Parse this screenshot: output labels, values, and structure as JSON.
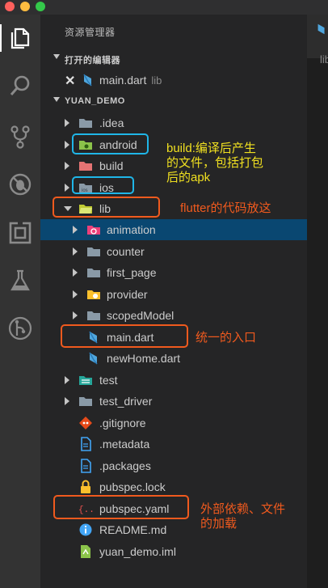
{
  "sidebar": {
    "title": "资源管理器",
    "open_editors": {
      "header": "打开的编辑器",
      "items": [
        {
          "name": "main.dart",
          "desc": "lib"
        }
      ]
    },
    "project": {
      "header": "YUAN_DEMO",
      "items": [
        {
          "label": ".idea"
        },
        {
          "label": "android"
        },
        {
          "label": "build"
        },
        {
          "label": "ios"
        },
        {
          "label": "lib"
        },
        {
          "label": "animation"
        },
        {
          "label": "counter"
        },
        {
          "label": "first_page"
        },
        {
          "label": "provider"
        },
        {
          "label": "scopedModel"
        },
        {
          "label": "main.dart"
        },
        {
          "label": "newHome.dart"
        },
        {
          "label": "test"
        },
        {
          "label": "test_driver"
        },
        {
          "label": ".gitignore"
        },
        {
          "label": ".metadata"
        },
        {
          "label": ".packages"
        },
        {
          "label": "pubspec.lock"
        },
        {
          "label": "pubspec.yaml"
        },
        {
          "label": "README.md"
        },
        {
          "label": "yuan_demo.iml"
        }
      ]
    }
  },
  "editor": {
    "tab_fragment": "lib"
  },
  "annotations": {
    "build_note": "build:编译后产生\n的文件，包括打包\n后的apk",
    "lib_note": "flutter的代码放这",
    "main_note": "统一的入口",
    "pubspec_note": "外部依赖、文件\n的加载"
  },
  "colors": {
    "annotation_yellow": "#f0e020",
    "annotation_orange": "#f05a1e",
    "annotation_blue": "#1fb6e8",
    "selected_row": "#094771",
    "sidebar_bg": "#252526",
    "activity_bg": "#333333"
  },
  "icons": [
    "files-icon",
    "search-icon",
    "source-control-icon",
    "debug-icon",
    "extensions-icon",
    "flask-icon",
    "git-graph-icon"
  ]
}
